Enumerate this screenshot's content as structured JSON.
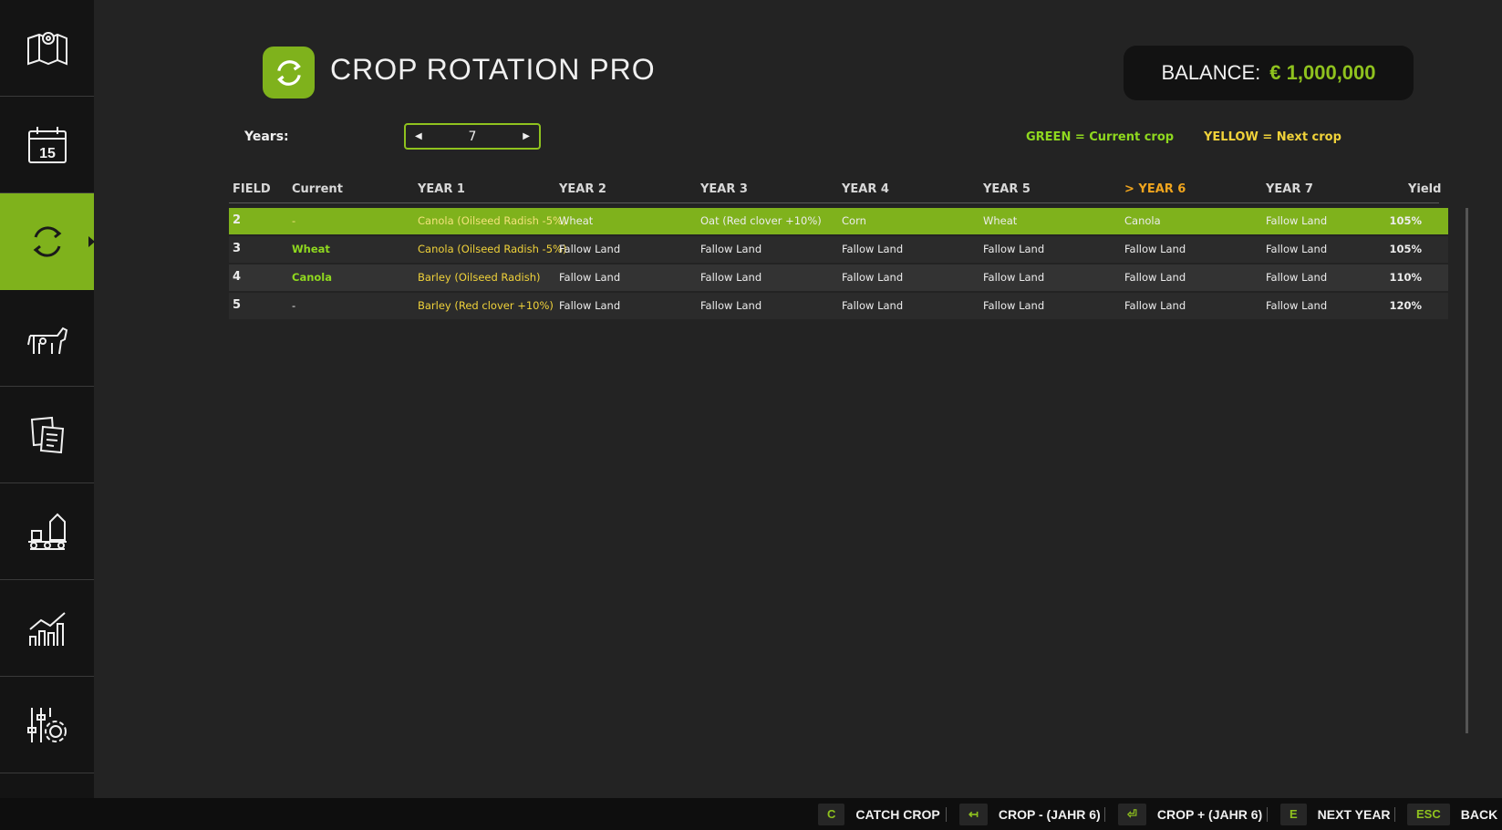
{
  "header": {
    "title": "CROP ROTATION PRO",
    "balance_label": "BALANCE:",
    "balance_value": "€ 1,000,000"
  },
  "sidebar": {
    "items": [
      {
        "icon": "map-icon"
      },
      {
        "icon": "calendar-icon",
        "text": "15"
      },
      {
        "icon": "rotation-icon",
        "active": true
      },
      {
        "icon": "animals-icon"
      },
      {
        "icon": "contracts-icon"
      },
      {
        "icon": "production-icon"
      },
      {
        "icon": "statistics-icon"
      },
      {
        "icon": "settings-icon"
      }
    ]
  },
  "years": {
    "label": "Years:",
    "value": "7"
  },
  "legend": {
    "green": "GREEN = Current crop",
    "yellow": "YELLOW = Next crop"
  },
  "table": {
    "headers": [
      "FIELD",
      "Current",
      "YEAR 1",
      "YEAR 2",
      "YEAR 3",
      "YEAR 4",
      "YEAR 5",
      "> YEAR 6",
      "YEAR 7",
      "Yield"
    ],
    "rows": [
      {
        "field": "2",
        "current": "-",
        "years": [
          "Canola (Oilseed Radish -5%)",
          "Wheat",
          "Oat (Red clover +10%)",
          "Corn",
          "Wheat",
          "Canola",
          "Fallow Land"
        ],
        "yield": "105%"
      },
      {
        "field": "3",
        "current": "Wheat",
        "years": [
          "Canola (Oilseed Radish -5%)",
          "Fallow Land",
          "Fallow Land",
          "Fallow Land",
          "Fallow Land",
          "Fallow Land",
          "Fallow Land"
        ],
        "yield": "105%"
      },
      {
        "field": "4",
        "current": "Canola",
        "years": [
          "Barley (Oilseed Radish)",
          "Fallow Land",
          "Fallow Land",
          "Fallow Land",
          "Fallow Land",
          "Fallow Land",
          "Fallow Land"
        ],
        "yield": "110%"
      },
      {
        "field": "5",
        "current": "-",
        "years": [
          "Barley (Red clover +10%)",
          "Fallow Land",
          "Fallow Land",
          "Fallow Land",
          "Fallow Land",
          "Fallow Land",
          "Fallow Land"
        ],
        "yield": "120%"
      }
    ]
  },
  "bottom_bar": {
    "hints": [
      {
        "key": "C",
        "label": "CATCH CROP"
      },
      {
        "key": "↤",
        "label": "CROP - (JAHR 6)"
      },
      {
        "key": "⏎",
        "label": "CROP + (JAHR 6)"
      },
      {
        "key": "E",
        "label": "NEXT YEAR"
      },
      {
        "key": "ESC",
        "label": "BACK"
      }
    ]
  },
  "colors": {
    "accent": "#7fb21c",
    "current_crop": "#8fd81f",
    "next_crop": "#f0d23a",
    "highlight_year": "#f0a51e"
  }
}
